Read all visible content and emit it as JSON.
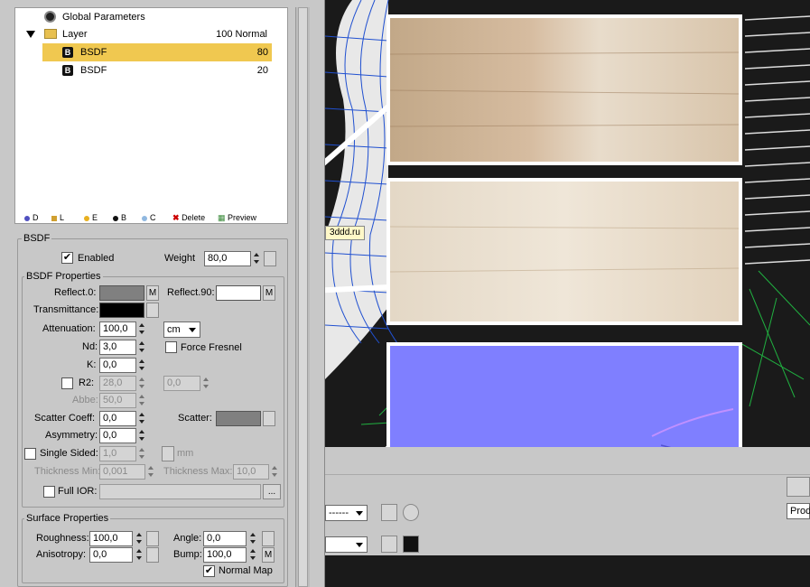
{
  "tree": {
    "global": "Global Parameters",
    "layer": {
      "name": "Layer",
      "value": "100 Normal"
    },
    "bsdf1": {
      "name": "BSDF",
      "value": "80",
      "icon": "B"
    },
    "bsdf2": {
      "name": "BSDF",
      "value": "20",
      "icon": "B"
    }
  },
  "toolbar": {
    "d": "D",
    "l": "L",
    "e": "E",
    "b": "B",
    "c": "C",
    "delete": "Delete",
    "preview": "Preview"
  },
  "bsdf": {
    "title": "BSDF",
    "enabled": "Enabled",
    "weight_label": "Weight",
    "weight": "80,0"
  },
  "props": {
    "title": "BSDF Properties",
    "reflect0": "Reflect.0:",
    "reflect90": "Reflect.90:",
    "m": "M",
    "transmittance": "Transmittance:",
    "attenuation": "Attenuation:",
    "attenuation_val": "100,0",
    "unit": "cm",
    "nd": "Nd:",
    "nd_val": "3,0",
    "force_fresnel": "Force Fresnel",
    "k": "K:",
    "k_val": "0,0",
    "r2": "R2:",
    "r2_a": "28,0",
    "r2_b": "0,0",
    "abbe": "Abbe:",
    "abbe_val": "50,0",
    "scatter_coeff": "Scatter Coeff:",
    "scatter_coeff_val": "0,0",
    "scatter": "Scatter:",
    "asymmetry": "Asymmetry:",
    "asymmetry_val": "0,0",
    "single_sided": "Single Sided:",
    "single_sided_val": "1,0",
    "mm": "mm",
    "thickness_min": "Thickness Min:",
    "thickness_min_val": "0,001",
    "thickness_max": "Thickness Max:",
    "thickness_max_val": "10,0",
    "full_ior": "Full IOR:",
    "ellipsis": "..."
  },
  "surface": {
    "title": "Surface Properties",
    "roughness": "Roughness:",
    "roughness_val": "100,0",
    "angle": "Angle:",
    "angle_val": "0,0",
    "anisotropy": "Anisotropy:",
    "anisotropy_val": "0,0",
    "bump": "Bump:",
    "bump_val": "100,0",
    "normal_map": "Normal Map"
  },
  "watermark": "3ddd.ru",
  "bottom": {
    "dropdown_a": "------",
    "prod": "Prod"
  },
  "colors": {
    "selected_row": "#f0c850",
    "reflect0": "#808080",
    "reflect90": "#ffffff",
    "transmittance": "#000000",
    "scatter": "#808080",
    "normal_map": "#7f7fff"
  }
}
